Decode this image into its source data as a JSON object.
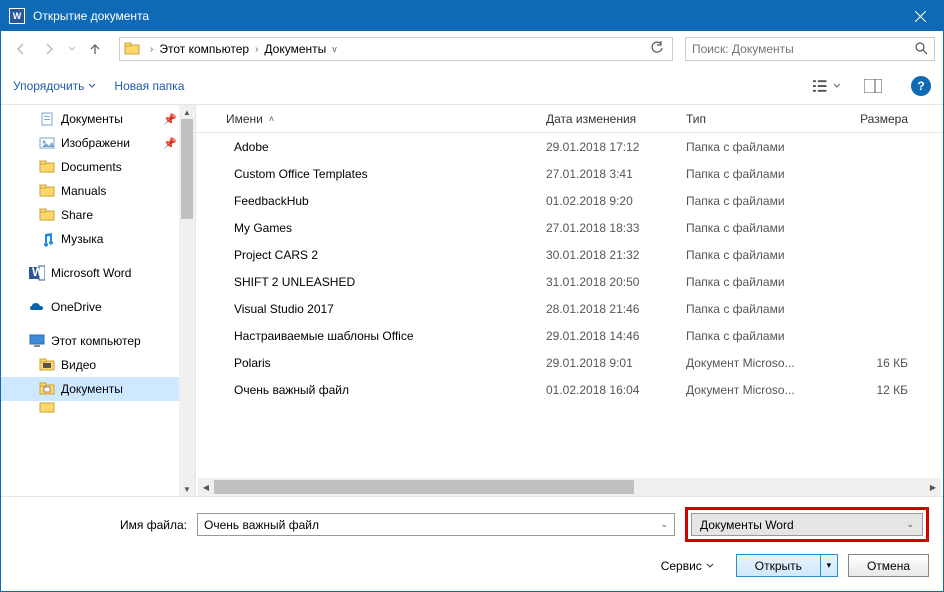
{
  "window": {
    "title": "Открытие документа"
  },
  "nav": {
    "crumbs": [
      "Этот компьютер",
      "Документы"
    ],
    "search_placeholder": "Поиск: Документы"
  },
  "toolbar": {
    "organize": "Упорядочить",
    "new_folder": "Новая папка"
  },
  "columns": {
    "name": "Имени",
    "date": "Дата изменения",
    "type": "Тип",
    "size": "Размера"
  },
  "sidebar": {
    "items": [
      {
        "label": "Документы",
        "icon": "documents",
        "pinned": true
      },
      {
        "label": "Изображени",
        "icon": "images",
        "pinned": true
      },
      {
        "label": "Documents",
        "icon": "folder"
      },
      {
        "label": "Manuals",
        "icon": "folder"
      },
      {
        "label": "Share",
        "icon": "folder"
      },
      {
        "label": "Музыка",
        "icon": "music"
      }
    ],
    "word": "Microsoft Word",
    "onedrive": "OneDrive",
    "thispc": "Этот компьютер",
    "video": "Видео",
    "documents": "Документы"
  },
  "files": [
    {
      "name": "Adobe",
      "date": "29.01.2018 17:12",
      "type": "Папка с файлами",
      "size": "",
      "kind": "folder"
    },
    {
      "name": "Custom Office Templates",
      "date": "27.01.2018 3:41",
      "type": "Папка с файлами",
      "size": "",
      "kind": "folder"
    },
    {
      "name": "FeedbackHub",
      "date": "01.02.2018 9:20",
      "type": "Папка с файлами",
      "size": "",
      "kind": "folder"
    },
    {
      "name": "My Games",
      "date": "27.01.2018 18:33",
      "type": "Папка с файлами",
      "size": "",
      "kind": "folder"
    },
    {
      "name": "Project CARS 2",
      "date": "30.01.2018 21:32",
      "type": "Папка с файлами",
      "size": "",
      "kind": "folder"
    },
    {
      "name": "SHIFT 2 UNLEASHED",
      "date": "31.01.2018 20:50",
      "type": "Папка с файлами",
      "size": "",
      "kind": "folder"
    },
    {
      "name": "Visual Studio 2017",
      "date": "28.01.2018 21:46",
      "type": "Папка с файлами",
      "size": "",
      "kind": "folder"
    },
    {
      "name": "Настраиваемые шаблоны Office",
      "date": "29.01.2018 14:46",
      "type": "Папка с файлами",
      "size": "",
      "kind": "folder"
    },
    {
      "name": "Polaris",
      "date": "29.01.2018 9:01",
      "type": "Документ Microso...",
      "size": "16 КБ",
      "kind": "word"
    },
    {
      "name": "Очень важный файл",
      "date": "01.02.2018 16:04",
      "type": "Документ Microso...",
      "size": "12 КБ",
      "kind": "word"
    }
  ],
  "footer": {
    "filename_label": "Имя файла:",
    "filename_value": "Очень важный файл",
    "filter": "Документы Word",
    "service": "Сервис",
    "open": "Открыть",
    "cancel": "Отмена"
  }
}
